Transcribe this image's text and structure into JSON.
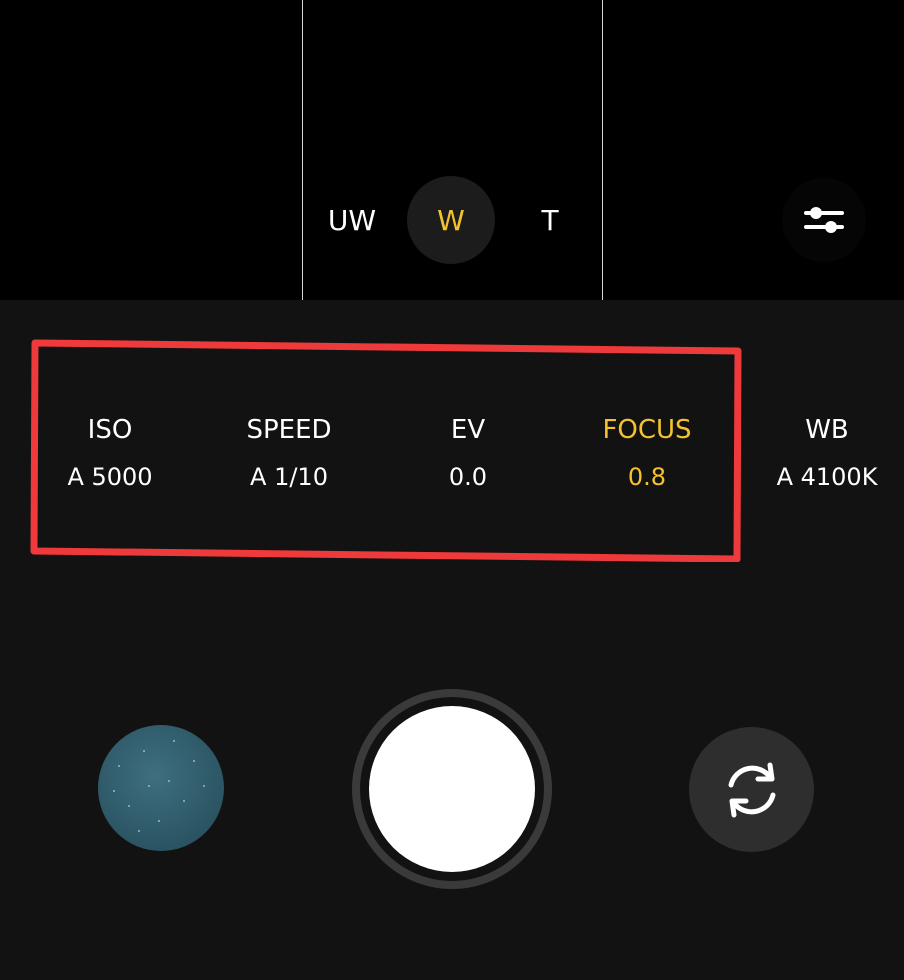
{
  "lenses": [
    {
      "label": "UW",
      "active": false
    },
    {
      "label": "W",
      "active": true
    },
    {
      "label": "T",
      "active": false
    }
  ],
  "controls": [
    {
      "label": "ISO",
      "value": "A 5000"
    },
    {
      "label": "SPEED",
      "value": "A 1/10"
    },
    {
      "label": "EV",
      "value": "0.0"
    },
    {
      "label": "FOCUS",
      "value": "0.8",
      "active": true
    },
    {
      "label": "WB",
      "value": "A 4100K"
    }
  ],
  "icons": {
    "settings": "sliders-icon",
    "switch_camera": "rotate-camera-icon",
    "gallery": "gallery-thumbnail"
  },
  "colors": {
    "accent": "#f3c22e",
    "highlight": "#ee3a3a",
    "background": "#121212",
    "viewfinder": "#000000"
  }
}
